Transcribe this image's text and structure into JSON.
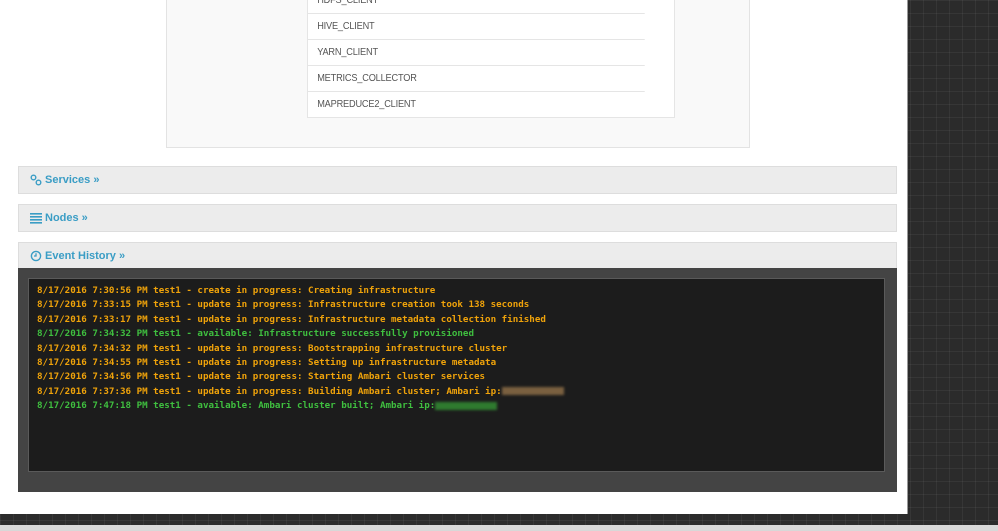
{
  "components_list": [
    "HDFS_CLIENT",
    "HIVE_CLIENT",
    "YARN_CLIENT",
    "METRICS_COLLECTOR",
    "MAPREDUCE2_CLIENT"
  ],
  "panels": {
    "services": {
      "label": "Services »",
      "icon": "link-icon"
    },
    "nodes": {
      "label": "Nodes »",
      "icon": "list-icon"
    },
    "event_history": {
      "label": "Event History »",
      "icon": "clock-icon"
    }
  },
  "colors": {
    "in_progress": "#f0a30a",
    "available": "#3fbf3f",
    "link": "#3a9dc5"
  },
  "events": [
    {
      "text": "8/17/2016 7:30:56 PM test1 - create in progress: Creating infrastructure",
      "status": "in_progress"
    },
    {
      "text": "8/17/2016 7:33:15 PM test1 - update in progress: Infrastructure creation took 138 seconds",
      "status": "in_progress"
    },
    {
      "text": "8/17/2016 7:33:17 PM test1 - update in progress: Infrastructure metadata collection finished",
      "status": "in_progress"
    },
    {
      "text": "8/17/2016 7:34:32 PM test1 - available: Infrastructure successfully provisioned",
      "status": "available"
    },
    {
      "text": "8/17/2016 7:34:32 PM test1 - update in progress: Bootstrapping infrastructure cluster",
      "status": "in_progress"
    },
    {
      "text": "8/17/2016 7:34:55 PM test1 - update in progress: Setting up infrastructure metadata",
      "status": "in_progress"
    },
    {
      "text": "8/17/2016 7:34:56 PM test1 - update in progress: Starting Ambari cluster services",
      "status": "in_progress"
    },
    {
      "text": "8/17/2016 7:37:36 PM test1 - update in progress: Building Ambari cluster; Ambari ip:",
      "status": "in_progress",
      "redacted": true
    },
    {
      "text": "8/17/2016 7:47:18 PM test1 - available: Ambari cluster built; Ambari ip:",
      "status": "available",
      "redacted": true
    }
  ]
}
